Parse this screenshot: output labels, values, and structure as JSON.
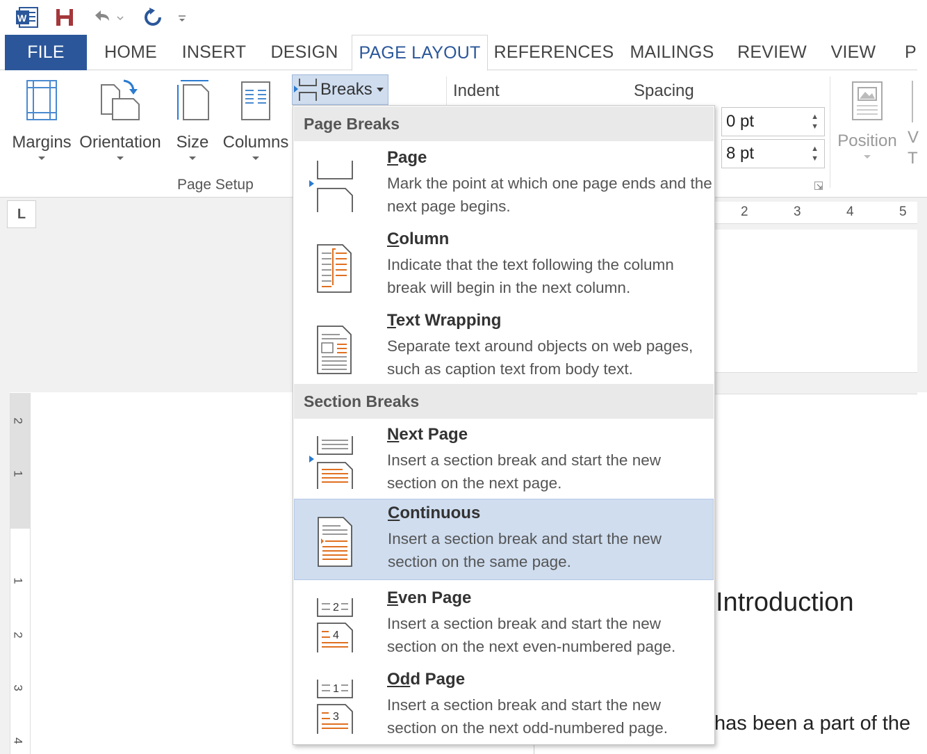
{
  "qat": {
    "app_icon": "word-icon",
    "save_icon": "save-icon",
    "undo_icon": "undo-icon",
    "redo_icon": "redo-icon",
    "customize_icon": "customize-qat-icon"
  },
  "tabs": [
    {
      "label": "FILE"
    },
    {
      "label": "HOME"
    },
    {
      "label": "INSERT"
    },
    {
      "label": "DESIGN"
    },
    {
      "label": "PAGE LAYOUT"
    },
    {
      "label": "REFERENCES"
    },
    {
      "label": "MAILINGS"
    },
    {
      "label": "REVIEW"
    },
    {
      "label": "VIEW"
    },
    {
      "label": "P"
    }
  ],
  "ribbon": {
    "margins_label": "Margins",
    "orientation_label": "Orientation",
    "size_label": "Size",
    "columns_label": "Columns",
    "page_setup_label": "Page Setup",
    "breaks_label": "Breaks",
    "indent_label": "Indent",
    "spacing_label": "Spacing",
    "spacing_before": "0 pt",
    "spacing_after": "8 pt",
    "position_label": "Position",
    "wrap_label_top": "V",
    "wrap_label_bottom": "T"
  },
  "ruler": {
    "corner": "L",
    "h_ticks": [
      "2",
      "3",
      "4",
      "5"
    ],
    "v_ticks": [
      "2",
      "1",
      "1",
      "2",
      "3",
      "4"
    ]
  },
  "document": {
    "heading": "Introduction",
    "text": "has been a part of the"
  },
  "menu": {
    "page_breaks_header": "Page Breaks",
    "section_breaks_header": "Section Breaks",
    "items": [
      {
        "first": "P",
        "rest": "age",
        "desc": "Mark the point at which one page ends and the next page begins."
      },
      {
        "first": "C",
        "rest": "olumn",
        "desc": "Indicate that the text following the column break will begin in the next column."
      },
      {
        "first": "T",
        "rest": "ext Wrapping",
        "desc": "Separate text around objects on web pages, such as caption text from body text."
      },
      {
        "first": "N",
        "rest": "ext Page",
        "desc": "Insert a section break and start the new section on the next page."
      },
      {
        "first": "C",
        "rest": "ontinuous",
        "desc": "Insert a section break and start the new section on the same page."
      },
      {
        "first": "E",
        "rest": "ven Page",
        "desc": "Insert a section break and start the new section on the next even-numbered page."
      },
      {
        "first": "O",
        "mid": "d",
        "rest": "d Page",
        "desc": "Insert a section break and start the new section on the next odd-numbered page."
      }
    ],
    "even_icon_nums": [
      "2",
      "4"
    ],
    "odd_icon_nums": [
      "1",
      "3"
    ]
  },
  "colors": {
    "file_tab": "#2b579a",
    "accent": "#2b579a",
    "hover": "#cfddef",
    "break_marker": "#e07020"
  }
}
